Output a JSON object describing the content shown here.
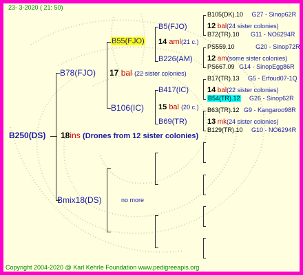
{
  "header": {
    "date": "23- 3-2020 ( 21: 50)"
  },
  "footer": {
    "copyright": "Copyright 2004-2020 @ Karl Kehrle Foundation www.pedigreeapis.org"
  },
  "root": {
    "name": "B250(DS)",
    "num": "18",
    "desc": "ins",
    "colonies": "(Drones from 12 sister colonies)"
  },
  "sire": {
    "name": "B78(FJO)",
    "num": "17",
    "desc": "bal",
    "colonies": "(22 sister colonies)"
  },
  "dam": {
    "name": "Bmix18(DS)",
    "more": "no more"
  },
  "gen3": {
    "b55": {
      "name": "B55(FJO)",
      "num": "14",
      "desc": "aml",
      "colonies": "(21 c.)"
    },
    "b106": {
      "name": "B106(IC)",
      "num": "15",
      "desc": "bal",
      "colonies": "(20 c.)"
    }
  },
  "gen4": {
    "b5": {
      "name": "B5(FJO)",
      "num": "12",
      "desc": "bal",
      "colonies": "(24 sister colonies)"
    },
    "b226": {
      "name": "B226(AM)",
      "num": "12",
      "desc": "am",
      "colonies": "(some sister colonies)"
    },
    "b417": {
      "name": "B417(IC)",
      "num": "14",
      "desc": "bal",
      "colonies": "(22 sister colonies)"
    },
    "b69": {
      "name": "B69(TR)",
      "num": "13",
      "desc": "mk",
      "colonies": "(24 sister colonies)"
    }
  },
  "gen5": [
    {
      "name": "B105(DK).10",
      "code": "G27 - Sinop62R"
    },
    {
      "name": "B72(TR).10",
      "code": "G11 - NO6294R"
    },
    {
      "name": "PS559.10",
      "code": "G20 - Sinop72R"
    },
    {
      "name": "PS667.09",
      "code": "G14 - SinopEgg86R"
    },
    {
      "name": "B17(TR).13",
      "code": "G5 - Erfoud07-1Q"
    },
    {
      "name": "B54(TR).12",
      "code": "G26 - Sinop62R"
    },
    {
      "name": "B63(TR).12",
      "code": "G9 - Kangaroo98R"
    },
    {
      "name": "B129(TR).10",
      "code": "G10 - NO6294R"
    }
  ],
  "colors": {
    "border": "#FF00CC",
    "background": "#FFFFE0",
    "highlight_b55": "#FFFF00",
    "highlight_b54": "#00FFFF"
  }
}
